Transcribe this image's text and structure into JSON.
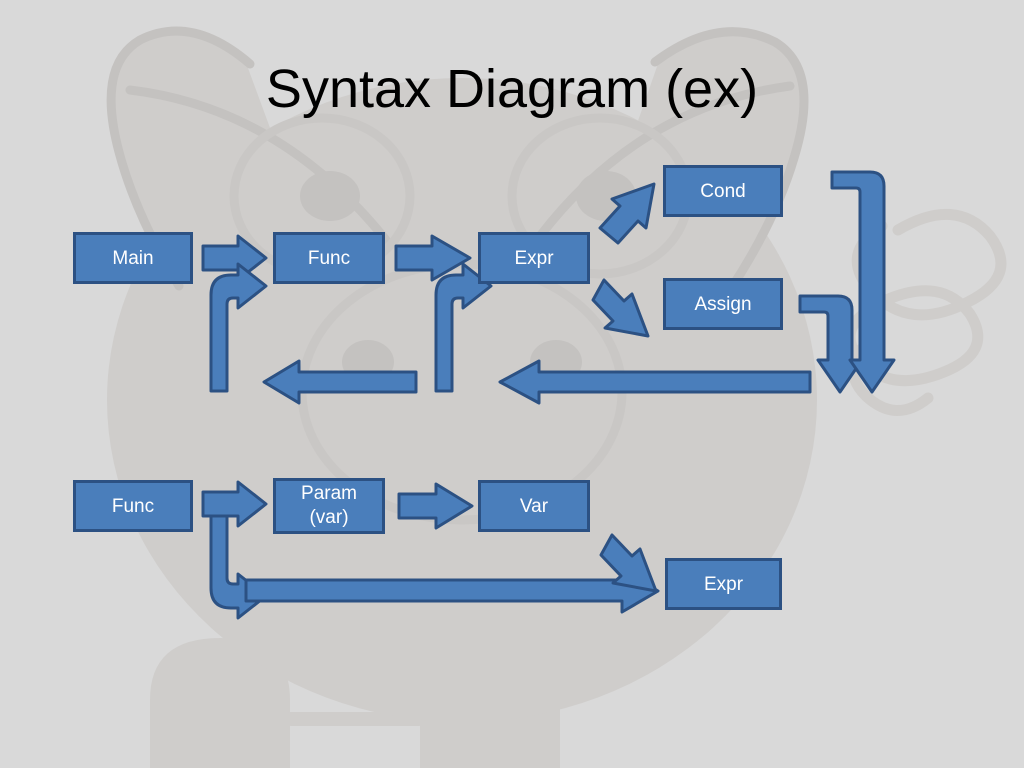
{
  "slide": {
    "title": "Syntax Diagram (ex)",
    "background_color": "#d9d9d9",
    "watermark": "pig-watermark"
  },
  "theme": {
    "node_fill": "#4a7ebb",
    "node_border": "#2c5183",
    "node_text": "#ffffff",
    "arrow_fill": "#4a7ebb",
    "arrow_border": "#2c5183",
    "title_color": "#000000"
  },
  "diagram": {
    "rows": [
      {
        "name": "statement-grammar-row",
        "nodes": [
          {
            "id": "main",
            "label": "Main"
          },
          {
            "id": "func",
            "label": "Func"
          },
          {
            "id": "expr",
            "label": "Expr"
          },
          {
            "id": "cond",
            "label": "Cond"
          },
          {
            "id": "assign",
            "label": "Assign"
          }
        ]
      },
      {
        "name": "function-grammar-row",
        "nodes": [
          {
            "id": "func2",
            "label": "Func"
          },
          {
            "id": "param",
            "label_line1": "Param",
            "label_line2": "(var)"
          },
          {
            "id": "var",
            "label": "Var"
          },
          {
            "id": "expr2",
            "label": "Expr"
          }
        ]
      }
    ],
    "connectors": [
      {
        "id": "main-to-func",
        "kind": "arrow-right"
      },
      {
        "id": "func-to-expr",
        "kind": "arrow-right"
      },
      {
        "id": "expr-to-cond",
        "kind": "arrow-diagonal-up-right"
      },
      {
        "id": "expr-to-assign",
        "kind": "arrow-diagonal-down-right"
      },
      {
        "id": "func-loop-back",
        "kind": "arrow-u-turn-up-right"
      },
      {
        "id": "func-return-line",
        "kind": "arrow-left"
      },
      {
        "id": "expr-loop-back",
        "kind": "arrow-u-turn-up-right"
      },
      {
        "id": "expr-return-line",
        "kind": "arrow-left"
      },
      {
        "id": "cond-return-elbow",
        "kind": "arrow-elbow-down-left"
      },
      {
        "id": "assign-return-elbow",
        "kind": "arrow-elbow-down-left"
      },
      {
        "id": "func2-to-param",
        "kind": "arrow-right"
      },
      {
        "id": "param-to-var",
        "kind": "arrow-right"
      },
      {
        "id": "func2-loop-down",
        "kind": "arrow-u-turn-down-right"
      },
      {
        "id": "param-bypass-line",
        "kind": "arrow-right-long"
      },
      {
        "id": "var-to-expr2",
        "kind": "arrow-diagonal-down-right"
      }
    ]
  }
}
